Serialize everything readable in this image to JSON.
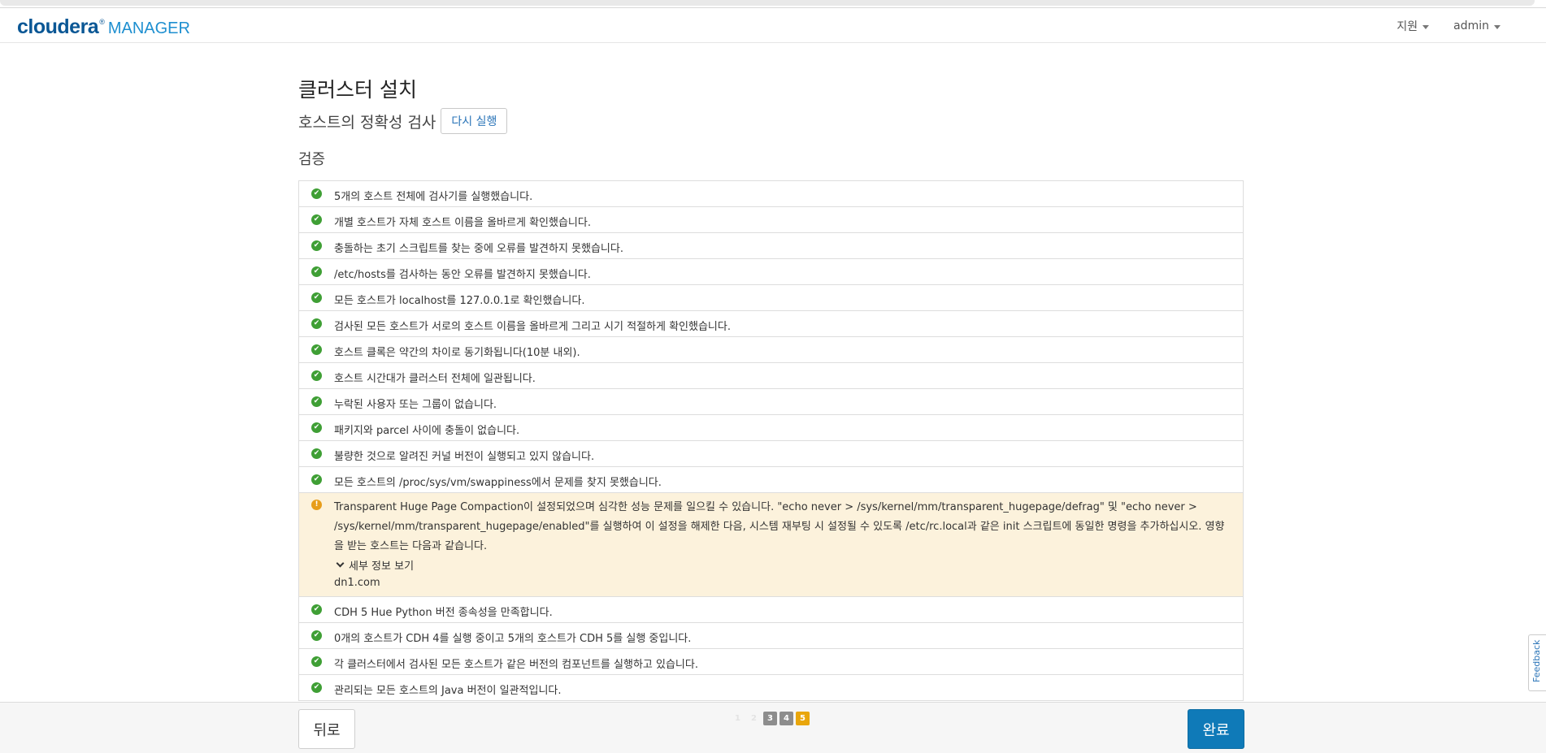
{
  "header": {
    "brand": "cloudera",
    "brand_mark": "®",
    "product": "MANAGER",
    "support_label": "지원",
    "user_label": "admin"
  },
  "page": {
    "title": "클러스터 설치",
    "subtitle": "호스트의 정확성 검사",
    "rerun_label": "다시 실행",
    "section_title": "검증"
  },
  "checks": [
    {
      "status": "ok",
      "icon": "check-circle-icon",
      "text": "5개의 호스트 전체에 검사기를 실행했습니다."
    },
    {
      "status": "ok",
      "icon": "check-circle-icon",
      "text": "개별 호스트가 자체 호스트 이름을 올바르게 확인했습니다."
    },
    {
      "status": "ok",
      "icon": "check-circle-icon",
      "text": "충돌하는 초기 스크립트를 찾는 중에 오류를 발견하지 못했습니다."
    },
    {
      "status": "ok",
      "icon": "check-circle-icon",
      "text": "/etc/hosts를 검사하는 동안 오류를 발견하지 못했습니다."
    },
    {
      "status": "ok",
      "icon": "check-circle-icon",
      "text": "모든 호스트가 localhost를 127.0.0.1로 확인했습니다."
    },
    {
      "status": "ok",
      "icon": "check-circle-icon",
      "text": "검사된 모든 호스트가 서로의 호스트 이름을 올바르게 그리고 시기 적절하게 확인했습니다."
    },
    {
      "status": "ok",
      "icon": "check-circle-icon",
      "text": "호스트 클록은 약간의 차이로 동기화됩니다(10분 내외)."
    },
    {
      "status": "ok",
      "icon": "check-circle-icon",
      "text": "호스트 시간대가 클러스터 전체에 일관됩니다."
    },
    {
      "status": "ok",
      "icon": "check-circle-icon",
      "text": "누락된 사용자 또는 그룹이 없습니다."
    },
    {
      "status": "ok",
      "icon": "check-circle-icon",
      "text": "패키지와 parcel 사이에 충돌이 없습니다."
    },
    {
      "status": "ok",
      "icon": "check-circle-icon",
      "text": "불량한 것으로 알려진 커널 버전이 실행되고 있지 않습니다."
    },
    {
      "status": "ok",
      "icon": "check-circle-icon",
      "text": "모든 호스트의 /proc/sys/vm/swappiness에서 문제를 찾지 못했습니다."
    }
  ],
  "warning": {
    "status": "warning",
    "icon": "exclamation-circle-icon",
    "text": "Transparent Huge Page Compaction이 설정되었으며 심각한 성능 문제를 일으킬 수 있습니다. \"echo never > /sys/kernel/mm/transparent_hugepage/defrag\" 및 \"echo never > /sys/kernel/mm/transparent_hugepage/enabled\"를 실행하여 이 설정을 해제한 다음, 시스템 재부팅 시 설정될 수 있도록 /etc/rc.local과 같은 init 스크립트에 동일한 명령을 추가하십시오. 영향을 받는 호스트는 다음과 같습니다.",
    "details_label": "세부 정보 보기",
    "hosts": "dn1.com"
  },
  "checks_after": [
    {
      "status": "ok",
      "icon": "check-circle-icon",
      "text": "CDH 5 Hue Python 버전 종속성을 만족합니다."
    },
    {
      "status": "ok",
      "icon": "check-circle-icon",
      "text": "0개의 호스트가 CDH 4를 실행 중이고 5개의 호스트가 CDH 5를 실행 중입니다."
    },
    {
      "status": "ok",
      "icon": "check-circle-icon",
      "text": "각 클러스터에서 검사된 모든 호스트가 같은 버전의 컴포넌트를 실행하고 있습니다."
    },
    {
      "status": "ok",
      "icon": "check-circle-icon",
      "text": "관리되는 모든 호스트의 Java 버전이 일관적입니다."
    }
  ],
  "footer": {
    "back_label": "뒤로",
    "finish_label": "완료",
    "steps": [
      {
        "label": "1",
        "state": "faint"
      },
      {
        "label": "2",
        "state": "faint"
      },
      {
        "label": "3",
        "state": "done"
      },
      {
        "label": "4",
        "state": "done"
      },
      {
        "label": "5",
        "state": "current"
      }
    ]
  },
  "feedback_label": "Feedback",
  "colors": {
    "brand": "#0a5795",
    "accent": "#1e8fd0",
    "ok": "#3f9f35",
    "warning": "#e79d1b",
    "warning_bg": "#fcf2dc",
    "primary_button": "#0f7ab8",
    "step_current": "#e9a60c"
  }
}
